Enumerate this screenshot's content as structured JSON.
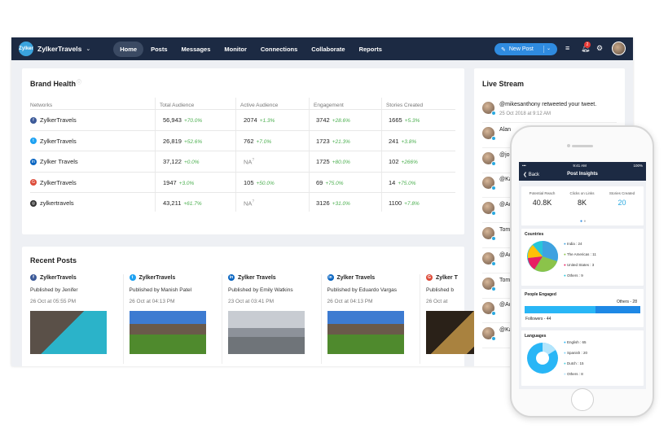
{
  "nav": {
    "brand": "ZylkerTravels",
    "logo_text": "Zylker",
    "items": [
      "Home",
      "Posts",
      "Messages",
      "Monitor",
      "Connections",
      "Collaborate",
      "Reports"
    ],
    "active": "Home",
    "new_post": "New Post",
    "notif_count": "2"
  },
  "brand_health": {
    "title": "Brand Health",
    "headers": [
      "Networks",
      "Total Audience",
      "Active Audience",
      "Engagement",
      "Stories Created"
    ],
    "rows": [
      {
        "network": "ZylkerTravels",
        "icon": "facebook-icon",
        "color": "#3b5998",
        "glyph": "f",
        "total": "56,943",
        "total_ch": "+70.0%",
        "active": "2074",
        "active_ch": "+1.3%",
        "eng": "3742",
        "eng_ch": "+28.6%",
        "stories": "1665",
        "stories_ch": "+5.3%"
      },
      {
        "network": "ZylkerTravels",
        "icon": "twitter-icon",
        "color": "#1da1f2",
        "glyph": "t",
        "total": "26,819",
        "total_ch": "+52.6%",
        "active": "762",
        "active_ch": "+7.0%",
        "eng": "1723",
        "eng_ch": "+21.3%",
        "stories": "241",
        "stories_ch": "+3.8%"
      },
      {
        "network": "Zylker Travels",
        "icon": "linkedin-icon",
        "color": "#0a66c2",
        "glyph": "in",
        "total": "37,122",
        "total_ch": "+0.0%",
        "active": "NA",
        "active_ch": "",
        "eng": "1725",
        "eng_ch": "+80.0%",
        "stories": "102",
        "stories_ch": "+266%"
      },
      {
        "network": "ZylkerTravels",
        "icon": "google-plus-icon",
        "color": "#dd4b39",
        "glyph": "G",
        "total": "1947",
        "total_ch": "+3.0%",
        "active": "105",
        "active_ch": "+50.0%",
        "eng": "69",
        "eng_ch": "+75.0%",
        "stories": "14",
        "stories_ch": "+75.0%"
      },
      {
        "network": "zylkertravels",
        "icon": "instagram-icon",
        "color": "#333333",
        "glyph": "◎",
        "total": "43,211",
        "total_ch": "+61.7%",
        "active": "NA",
        "active_ch": "",
        "eng": "3126",
        "eng_ch": "+31.0%",
        "stories": "1100",
        "stories_ch": "+7.8%"
      }
    ]
  },
  "recent_posts": {
    "title": "Recent Posts",
    "posts": [
      {
        "network": "ZylkerTravels",
        "icon": "facebook-icon",
        "color": "#3b5998",
        "glyph": "f",
        "by": "Published by Jenifer",
        "date": "26 Oct at 05:55 PM"
      },
      {
        "network": "ZylkerTravels",
        "icon": "twitter-icon",
        "color": "#1da1f2",
        "glyph": "t",
        "by": "Published by Manish Patel",
        "date": "26 Oct at 04:13 PM"
      },
      {
        "network": "Zylker Travels",
        "icon": "linkedin-icon",
        "color": "#0a66c2",
        "glyph": "in",
        "by": "Published by Emily Watkins",
        "date": "23 Oct at 03:41 PM"
      },
      {
        "network": "Zylker Travels",
        "icon": "linkedin-icon",
        "color": "#0a66c2",
        "glyph": "in",
        "by": "Published by Eduardo Vargas",
        "date": "26 Oct at 04:13 PM"
      },
      {
        "network": "Zylker T",
        "icon": "google-plus-icon",
        "color": "#dd4b39",
        "glyph": "G",
        "by": "Published b",
        "date": "26 Oct at"
      }
    ]
  },
  "live_stream": {
    "title": "Live Stream",
    "items": [
      {
        "text": "@mikesanthony retweeted your tweet.",
        "time": "25 Oct 2018 at 9:12 AM"
      },
      {
        "text": "Alan",
        "time": ""
      },
      {
        "text": "@jo",
        "time": ""
      },
      {
        "text": "@Ka",
        "time": ""
      },
      {
        "text": "@Ad",
        "time": ""
      },
      {
        "text": "Tom",
        "time": ""
      },
      {
        "text": "@Ad",
        "time": ""
      },
      {
        "text": "Tom",
        "time": ""
      },
      {
        "text": "@Ad",
        "time": ""
      },
      {
        "text": "@Ka",
        "time": ""
      }
    ]
  },
  "phone": {
    "status_time": "9:41 AM",
    "battery": "100%",
    "back": "Back",
    "title": "Post Insights",
    "stats": [
      {
        "label": "Potential Reach",
        "value": "40.8K"
      },
      {
        "label": "Clicks on Links",
        "value": "8K"
      },
      {
        "label": "Stories Created",
        "value": "20"
      }
    ],
    "countries": {
      "title": "Countries",
      "items": [
        {
          "label": "India : 24",
          "color": "#3fa2e0"
        },
        {
          "label": "The Americas : 11",
          "color": "#8bc34a"
        },
        {
          "label": "United States : 3",
          "color": "#e91e63"
        },
        {
          "label": "Others : 9",
          "color": "#26c6da"
        }
      ]
    },
    "people": {
      "title": "People Engaged",
      "others": "Others - 28",
      "followers": "Followers - 44",
      "followers_frac": 0.61
    },
    "languages": {
      "title": "Languages",
      "items": [
        {
          "label": "English : 65",
          "color": "#29b6f6"
        },
        {
          "label": "Spanish : 20",
          "color": "#81d4fa"
        },
        {
          "label": "Dutch : 15",
          "color": "#4dd0e1"
        },
        {
          "label": "Others : 8",
          "color": "#b3e5fc"
        }
      ]
    }
  }
}
